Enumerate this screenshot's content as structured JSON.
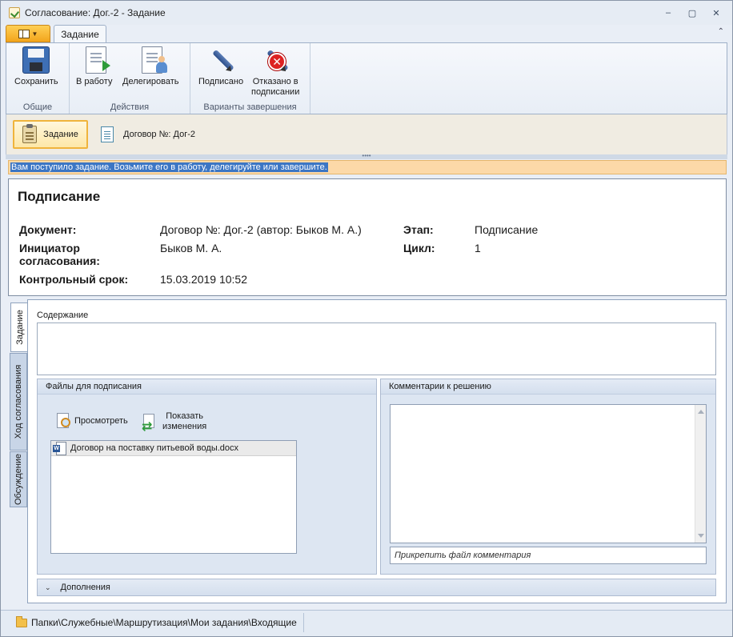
{
  "window": {
    "title": "Согласование: Дог.-2 - Задание",
    "controls": {
      "minimize": "‒",
      "maximize": "▢",
      "close": "✕"
    }
  },
  "ribbon": {
    "tab": "Задание",
    "groups": [
      {
        "label": "Общие",
        "buttons": [
          {
            "label": "Сохранить",
            "icon": "save-icon"
          }
        ]
      },
      {
        "label": "Действия",
        "buttons": [
          {
            "label": "В работу",
            "icon": "start-work-icon"
          },
          {
            "label": "Делегировать",
            "icon": "delegate-icon"
          }
        ]
      },
      {
        "label": "Варианты завершения",
        "buttons": [
          {
            "label": "Подписано",
            "icon": "sign-pen-icon"
          },
          {
            "label": "Отказано в подписании",
            "label_lines": [
              "Отказано в",
              "подписании"
            ],
            "icon": "reject-sign-icon"
          }
        ]
      }
    ]
  },
  "doc_tabs": [
    {
      "label": "Задание",
      "icon": "clipboard-icon",
      "active": true
    },
    {
      "label": "Договор №: Дог-2",
      "icon": "document-icon",
      "active": false
    }
  ],
  "notice": "Вам поступило задание. Возьмите его в работу, делегируйте или завершите.",
  "info": {
    "title": "Подписание",
    "document_label": "Документ:",
    "document_value": "Договор №: Дог.-2 (автор: Быков М. А.)",
    "initiator_label_line1": "Инициатор",
    "initiator_label_line2": "согласования:",
    "initiator_value": "Быков М. А.",
    "deadline_label": "Контрольный срок:",
    "deadline_value": "15.03.2019 10:52",
    "stage_label": "Этап:",
    "stage_value": "Подписание",
    "cycle_label": "Цикл:",
    "cycle_value": "1"
  },
  "side_tabs": [
    "Задание",
    "Ход согласования",
    "Обсуждение"
  ],
  "content": {
    "content_label": "Содержание",
    "files_panel": {
      "title": "Файлы для подписания",
      "view_button": "Просмотреть",
      "show_changes_line1": "Показать",
      "show_changes_line2": "изменения",
      "files": [
        "Договор на поставку питьевой воды.docx"
      ]
    },
    "comments_panel": {
      "title": "Комментарии к решению",
      "attach_placeholder": "Прикрепить файл комментария"
    },
    "addons_label": "Дополнения"
  },
  "status_bar": {
    "path": "Папки\\Служебные\\Маршрутизация\\Мои задания\\Входящие"
  }
}
